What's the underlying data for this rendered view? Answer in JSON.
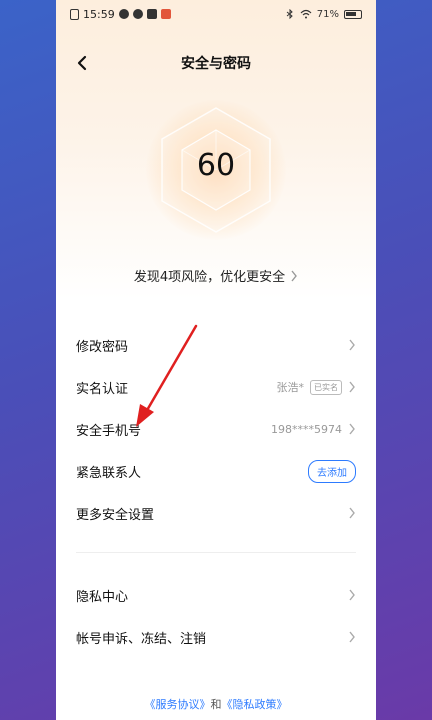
{
  "status_bar": {
    "time": "15:59",
    "battery": "71%"
  },
  "header": {
    "title": "安全与密码"
  },
  "score": {
    "value": "60"
  },
  "risk_banner": {
    "text": "发现4项风险，优化更安全"
  },
  "security_items": [
    {
      "label": "修改密码"
    },
    {
      "label": "实名认证",
      "value": "张浩*",
      "tag": "已实名"
    },
    {
      "label": "安全手机号",
      "value": "198****5974"
    },
    {
      "label": "紧急联系人",
      "button": "去添加"
    },
    {
      "label": "更多安全设置"
    }
  ],
  "privacy_items": [
    {
      "label": "隐私中心"
    },
    {
      "label": "帐号申诉、冻结、注销"
    }
  ],
  "footer": {
    "service_link": "《服务协议》",
    "connector": "和",
    "privacy_link": "《隐私政策》"
  },
  "colors": {
    "accent": "#2d7bff",
    "annotation_arrow": "#e02020"
  }
}
